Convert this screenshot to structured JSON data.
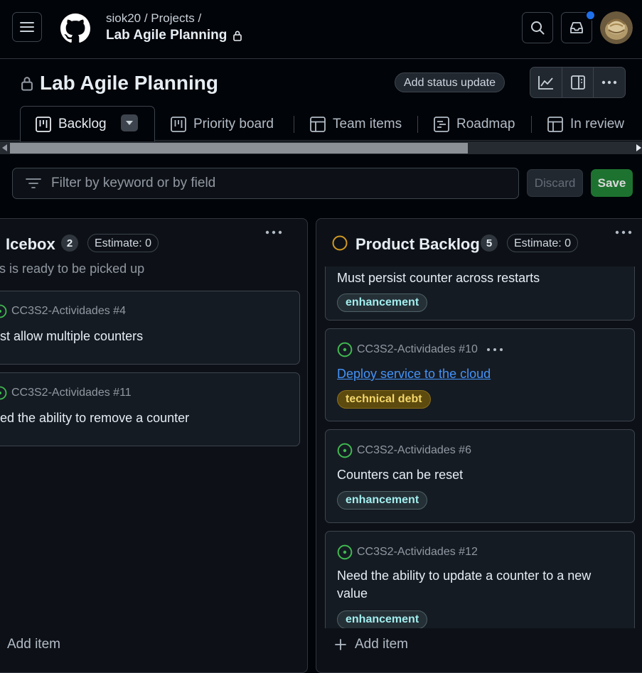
{
  "header": {
    "owner": "siok20",
    "section": "Projects",
    "project_title": "Lab Agile Planning",
    "breadcrumb_path": "siok20 / Projects /"
  },
  "project": {
    "title": "Lab Agile Planning",
    "status_button": "Add status update"
  },
  "tabs": [
    {
      "label": "Backlog",
      "active": true
    },
    {
      "label": "Priority board"
    },
    {
      "label": "Team items"
    },
    {
      "label": "Roadmap"
    },
    {
      "label": "In review"
    }
  ],
  "filter": {
    "placeholder": "Filter by keyword or by field",
    "discard_label": "Discard",
    "save_label": "Save"
  },
  "columns": {
    "icebox": {
      "name": "Icebox",
      "count": "2",
      "estimate": "Estimate: 0",
      "description": "s is ready to be picked up",
      "cards": [
        {
          "ref": "CC3S2-Actividades #4",
          "title": "ust allow multiple counters"
        },
        {
          "ref": "CC3S2-Actividades #11",
          "title": "eed the ability to remove a counter"
        }
      ],
      "add_item": "Add item"
    },
    "backlog": {
      "name": "Product Backlog",
      "count": "5",
      "estimate": "Estimate: 0",
      "cards": [
        {
          "title": "Must persist counter across restarts",
          "label": "enhancement"
        },
        {
          "ref": "CC3S2-Actividades #10",
          "title": "Deploy service to the cloud",
          "label": "technical debt"
        },
        {
          "ref": "CC3S2-Actividades #6",
          "title": "Counters can be reset",
          "label": "enhancement"
        },
        {
          "ref": "CC3S2-Actividades #12",
          "title": "Need the ability to update a counter to a new value",
          "label": "enhancement"
        }
      ],
      "add_item": "Add item"
    }
  },
  "colors": {
    "accent": "#1f6feb",
    "open_issue": "#3fb950",
    "save": "#238636",
    "status_circle": "#d29922"
  },
  "icons": [
    "hamburger-icon",
    "github-logo-icon",
    "lock-icon",
    "search-icon",
    "inbox-icon",
    "insights-icon",
    "sidebar-icon",
    "kebab-icon",
    "board-icon",
    "table-icon",
    "roadmap-icon",
    "triangle-down-icon",
    "filter-icon",
    "issue-open-icon",
    "plus-icon"
  ]
}
